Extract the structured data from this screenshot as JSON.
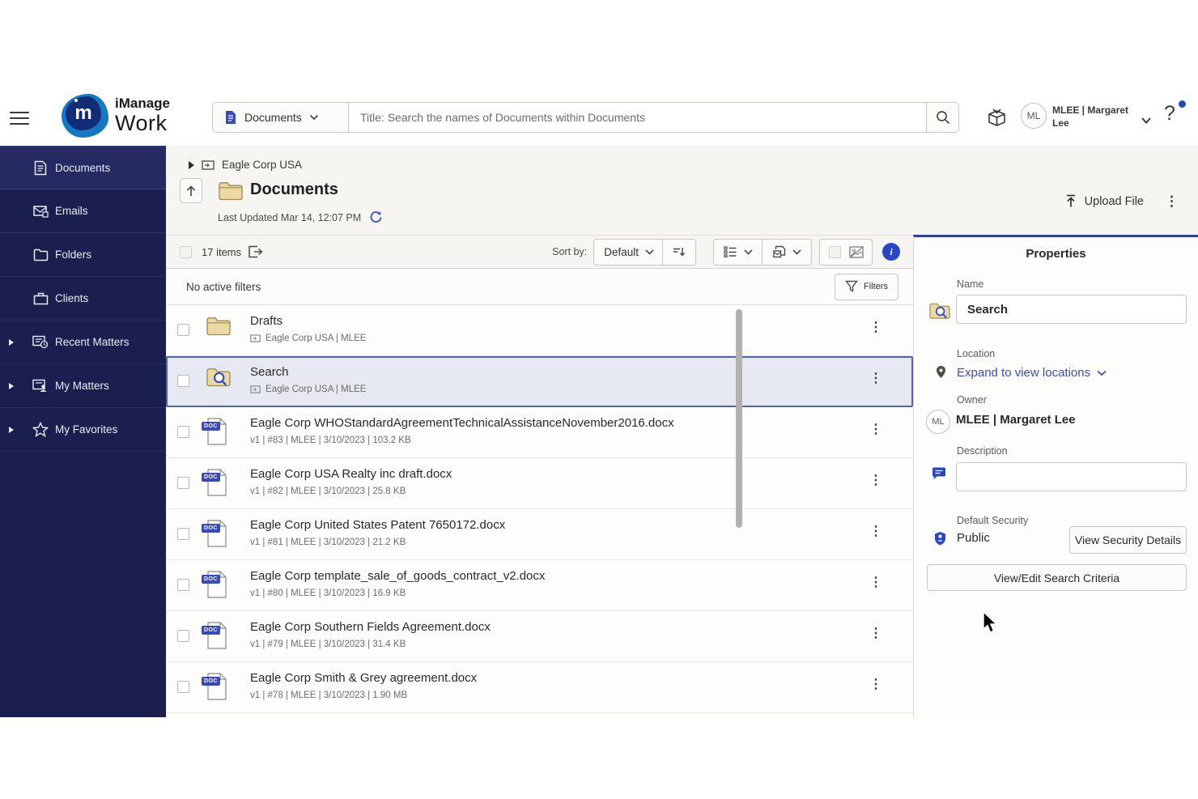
{
  "topbar": {
    "brand_top": "iManage",
    "brand_bottom": "Work",
    "monogram": "m",
    "search_scope": "Documents",
    "search_placeholder": "Title: Search the names of Documents within Documents",
    "user_initials": "ML",
    "user_name_line1": "MLEE | Margaret",
    "user_name_line2": "Lee",
    "help_label": "?"
  },
  "sidebar": {
    "items": [
      {
        "label": "Documents"
      },
      {
        "label": "Emails"
      },
      {
        "label": "Folders"
      },
      {
        "label": "Clients"
      },
      {
        "label": "Recent Matters"
      },
      {
        "label": "My Matters"
      },
      {
        "label": "My Favorites"
      }
    ]
  },
  "header": {
    "breadcrumb": "Eagle Corp USA",
    "title": "Documents",
    "last_updated": "Last Updated Mar 14, 12:07 PM",
    "upload_label": "Upload File",
    "kebab": "⋮"
  },
  "toolbar": {
    "items_count": "17 items",
    "sort_label": "Sort by:",
    "sort_value": "Default",
    "info_glyph": "i"
  },
  "filters": {
    "status": "No active filters",
    "button_label": "Filters"
  },
  "list": {
    "doc_badge": "DOC",
    "kebab": "⋮",
    "rows": [
      {
        "title": "Drafts",
        "subtitle": "Eagle Corp USA | MLEE"
      },
      {
        "title": "Search",
        "subtitle": "Eagle Corp USA | MLEE"
      },
      {
        "title": "Eagle Corp WHOStandardAgreementTechnicalAssistanceNovember2016.docx",
        "subtitle": "v1 | #83 | MLEE | 3/10/2023 | 103.2 KB"
      },
      {
        "title": "Eagle Corp USA Realty inc draft.docx",
        "subtitle": "v1 | #82 | MLEE | 3/10/2023 | 25.8 KB"
      },
      {
        "title": "Eagle Corp United States Patent 7650172.docx",
        "subtitle": "v1 | #81 | MLEE | 3/10/2023 | 21.2 KB"
      },
      {
        "title": "Eagle Corp template_sale_of_goods_contract_v2.docx",
        "subtitle": "v1 | #80 | MLEE | 3/10/2023 | 16.9 KB"
      },
      {
        "title": "Eagle Corp Southern Fields Agreement.docx",
        "subtitle": "v1 | #79 | MLEE | 3/10/2023 | 31.4 KB"
      },
      {
        "title": "Eagle Corp Smith & Grey agreement.docx",
        "subtitle": "v1 | #78 | MLEE | 3/10/2023 | 1.90 MB"
      }
    ]
  },
  "properties": {
    "title": "Properties",
    "name_label": "Name",
    "name_value": "Search",
    "location_label": "Location",
    "location_link": "Expand to view locations",
    "owner_label": "Owner",
    "owner_initials": "ML",
    "owner_value": "MLEE | Margaret Lee",
    "description_label": "Description",
    "description_value": "",
    "security_label": "Default Security",
    "security_value": "Public",
    "security_button": "View Security Details",
    "criteria_button": "View/Edit Search Criteria"
  },
  "colors": {
    "accent_blue": "#2946c8",
    "link_blue": "#3b4cc8",
    "sidebar_navy": "#1a1f4f",
    "selected_row_border": "#5661b2",
    "folder_yellow": "#ecd9a2"
  }
}
